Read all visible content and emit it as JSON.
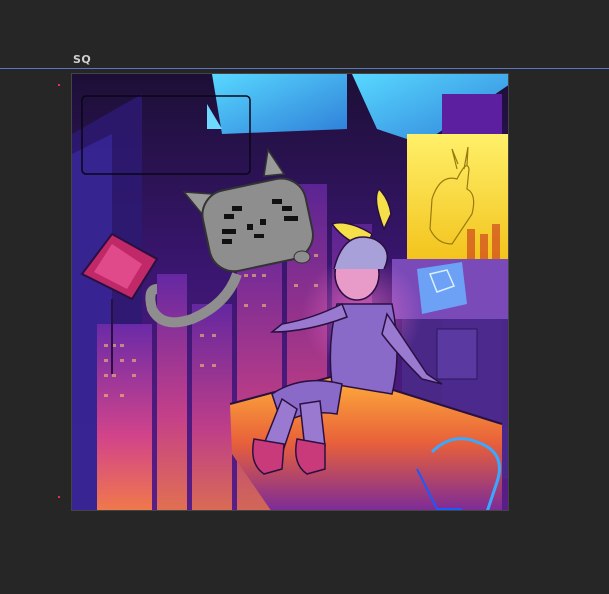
{
  "document": {
    "name": "SQ"
  },
  "colors": {
    "workspace": "#262626",
    "rule": "#5a76c8",
    "label": "#d0d0d0",
    "marker": "#d8354a"
  },
  "artwork": {
    "subject": "illustration-neon-city-room",
    "icons": [
      "cat-head-ornament-icon",
      "kite-ornament-icon",
      "hexagon-screen-icon"
    ]
  }
}
